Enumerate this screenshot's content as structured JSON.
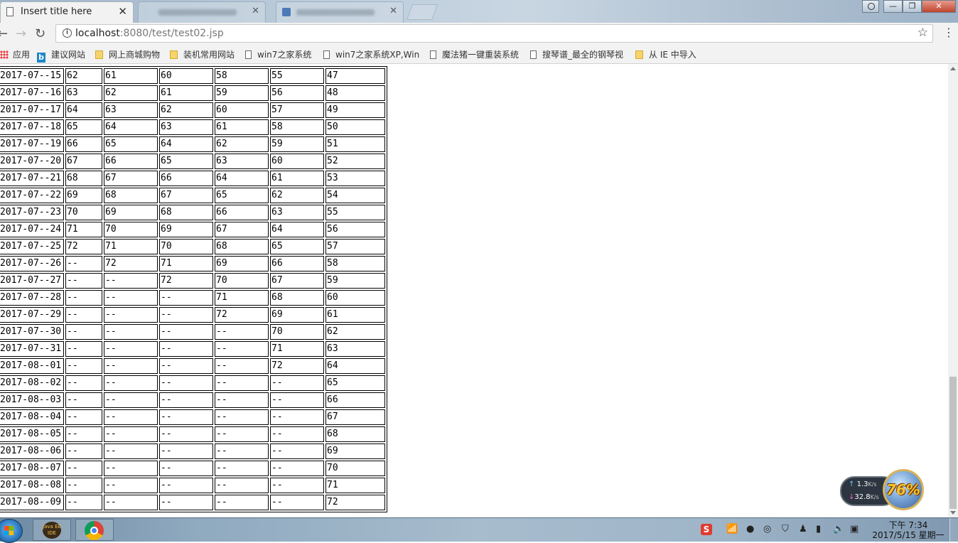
{
  "browser": {
    "active_tab_title": "Insert title here",
    "url_host": "localhost",
    "url_rest": ":8080/test/test02.jsp",
    "window_controls": {
      "minimize": "—",
      "restore": "❐",
      "close": "✕"
    }
  },
  "bookmarks": [
    {
      "label": "应用",
      "icon": "apps-icon"
    },
    {
      "label": "建议网站",
      "icon": "bing-icon"
    },
    {
      "label": "网上商城购物",
      "icon": "folder-icon"
    },
    {
      "label": "装机常用网站",
      "icon": "folder-icon"
    },
    {
      "label": "win7之家系统",
      "icon": "page-icon"
    },
    {
      "label": "win7之家系统XP,Win",
      "icon": "page-icon"
    },
    {
      "label": "魔法猪一键重装系统",
      "icon": "page-icon"
    },
    {
      "label": "搜琴谱_最全的钢琴视",
      "icon": "page-icon"
    },
    {
      "label": "从 IE 中导入",
      "icon": "folder-icon"
    }
  ],
  "table": {
    "rows": [
      [
        "2017-07--15",
        "62",
        "61",
        "60",
        "58",
        "55",
        "47"
      ],
      [
        "2017-07--16",
        "63",
        "62",
        "61",
        "59",
        "56",
        "48"
      ],
      [
        "2017-07--17",
        "64",
        "63",
        "62",
        "60",
        "57",
        "49"
      ],
      [
        "2017-07--18",
        "65",
        "64",
        "63",
        "61",
        "58",
        "50"
      ],
      [
        "2017-07--19",
        "66",
        "65",
        "64",
        "62",
        "59",
        "51"
      ],
      [
        "2017-07--20",
        "67",
        "66",
        "65",
        "63",
        "60",
        "52"
      ],
      [
        "2017-07--21",
        "68",
        "67",
        "66",
        "64",
        "61",
        "53"
      ],
      [
        "2017-07--22",
        "69",
        "68",
        "67",
        "65",
        "62",
        "54"
      ],
      [
        "2017-07--23",
        "70",
        "69",
        "68",
        "66",
        "63",
        "55"
      ],
      [
        "2017-07--24",
        "71",
        "70",
        "69",
        "67",
        "64",
        "56"
      ],
      [
        "2017-07--25",
        "72",
        "71",
        "70",
        "68",
        "65",
        "57"
      ],
      [
        "2017-07--26",
        "--",
        "72",
        "71",
        "69",
        "66",
        "58"
      ],
      [
        "2017-07--27",
        "--",
        "--",
        "72",
        "70",
        "67",
        "59"
      ],
      [
        "2017-07--28",
        "--",
        "--",
        "--",
        "71",
        "68",
        "60"
      ],
      [
        "2017-07--29",
        "--",
        "--",
        "--",
        "72",
        "69",
        "61"
      ],
      [
        "2017-07--30",
        "--",
        "--",
        "--",
        "--",
        "70",
        "62"
      ],
      [
        "2017-07--31",
        "--",
        "--",
        "--",
        "--",
        "71",
        "63"
      ],
      [
        "2017-08--01",
        "--",
        "--",
        "--",
        "--",
        "72",
        "64"
      ],
      [
        "2017-08--02",
        "--",
        "--",
        "--",
        "--",
        "--",
        "65"
      ],
      [
        "2017-08--03",
        "--",
        "--",
        "--",
        "--",
        "--",
        "66"
      ],
      [
        "2017-08--04",
        "--",
        "--",
        "--",
        "--",
        "--",
        "67"
      ],
      [
        "2017-08--05",
        "--",
        "--",
        "--",
        "--",
        "--",
        "68"
      ],
      [
        "2017-08--06",
        "--",
        "--",
        "--",
        "--",
        "--",
        "69"
      ],
      [
        "2017-08--07",
        "--",
        "--",
        "--",
        "--",
        "--",
        "70"
      ],
      [
        "2017-08--08",
        "--",
        "--",
        "--",
        "--",
        "--",
        "71"
      ],
      [
        "2017-08--09",
        "--",
        "--",
        "--",
        "--",
        "--",
        "72"
      ]
    ]
  },
  "net_widget": {
    "up_value": "1.3",
    "up_unit": "K/s",
    "down_value": "32.8",
    "down_unit": "K/s",
    "percent": "76%"
  },
  "taskbar": {
    "apps": [
      {
        "name": "Java EE IDE",
        "icon": "java-ee-ide-icon",
        "label": "Java EE IDE"
      },
      {
        "name": "Chrome",
        "icon": "chrome-icon"
      }
    ],
    "clock_time": "下午 7:34",
    "clock_date": "2017/5/15 星期一"
  }
}
